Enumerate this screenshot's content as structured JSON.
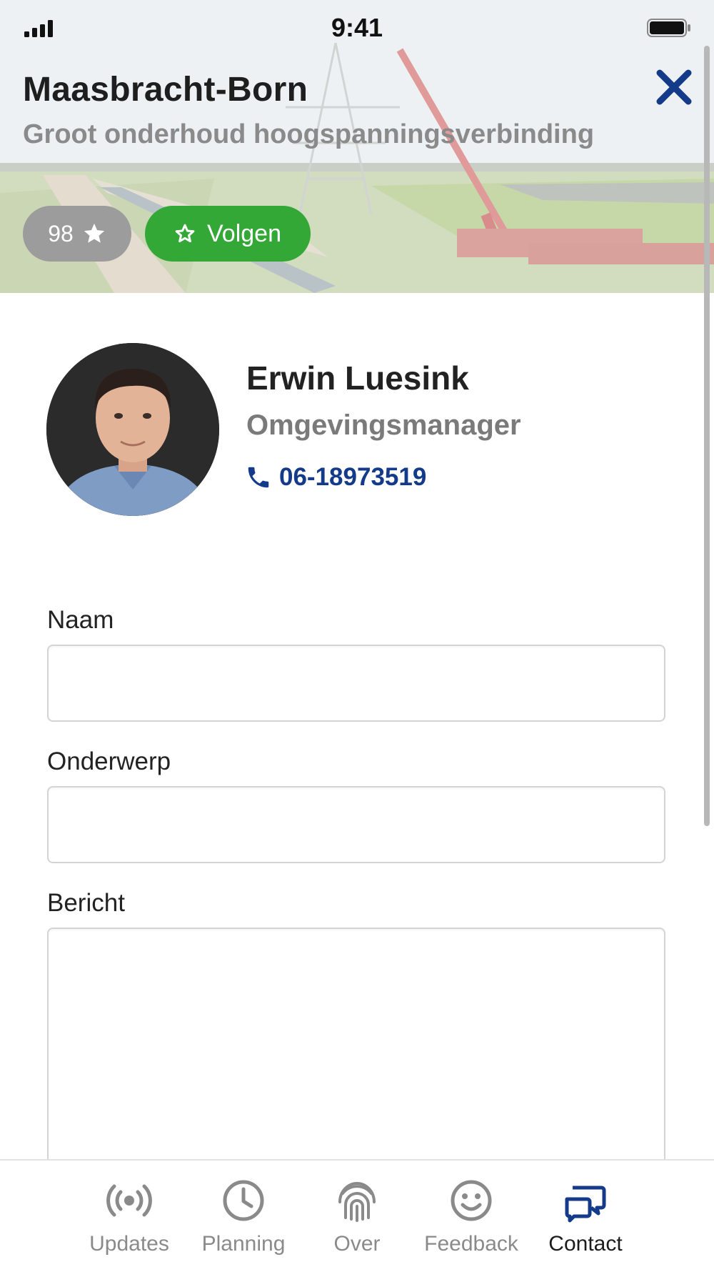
{
  "status_bar": {
    "time": "9:41"
  },
  "project": {
    "title": "Maasbracht-Born",
    "subtitle": "Groot onderhoud hoogspanningsverbinding",
    "follower_count": "98",
    "follow_label": "Volgen"
  },
  "contact": {
    "name": "Erwin Luesink",
    "role": "Omgevingsmanager",
    "phone": "06-18973519"
  },
  "form": {
    "name_label": "Naam",
    "name_value": "",
    "subject_label": "Onderwerp",
    "subject_value": "",
    "message_label": "Bericht",
    "message_value": ""
  },
  "tabs": [
    {
      "label": "Updates",
      "icon": "broadcast-icon"
    },
    {
      "label": "Planning",
      "icon": "clock-icon"
    },
    {
      "label": "Over",
      "icon": "fingerprint-icon"
    },
    {
      "label": "Feedback",
      "icon": "smiley-icon"
    },
    {
      "label": "Contact",
      "icon": "chat-icon"
    }
  ],
  "active_tab": "Contact",
  "colors": {
    "follow_green": "#33a837",
    "brand_blue": "#143a8a",
    "badge_gray": "#9c9c9c"
  }
}
